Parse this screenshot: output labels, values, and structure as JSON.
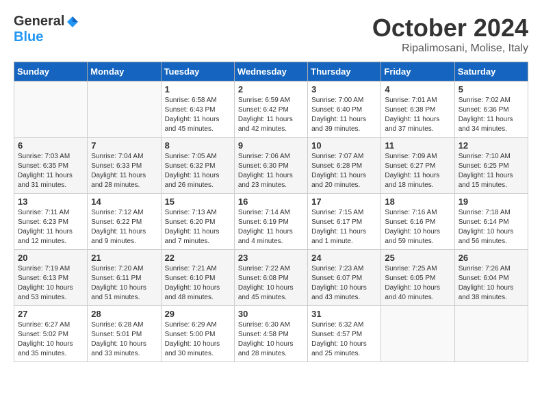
{
  "header": {
    "logo_general": "General",
    "logo_blue": "Blue",
    "month_title": "October 2024",
    "subtitle": "Ripalimosani, Molise, Italy"
  },
  "days_of_week": [
    "Sunday",
    "Monday",
    "Tuesday",
    "Wednesday",
    "Thursday",
    "Friday",
    "Saturday"
  ],
  "weeks": [
    [
      {
        "day": "",
        "info": ""
      },
      {
        "day": "",
        "info": ""
      },
      {
        "day": "1",
        "sunrise": "Sunrise: 6:58 AM",
        "sunset": "Sunset: 6:43 PM",
        "daylight": "Daylight: 11 hours and 45 minutes."
      },
      {
        "day": "2",
        "sunrise": "Sunrise: 6:59 AM",
        "sunset": "Sunset: 6:42 PM",
        "daylight": "Daylight: 11 hours and 42 minutes."
      },
      {
        "day": "3",
        "sunrise": "Sunrise: 7:00 AM",
        "sunset": "Sunset: 6:40 PM",
        "daylight": "Daylight: 11 hours and 39 minutes."
      },
      {
        "day": "4",
        "sunrise": "Sunrise: 7:01 AM",
        "sunset": "Sunset: 6:38 PM",
        "daylight": "Daylight: 11 hours and 37 minutes."
      },
      {
        "day": "5",
        "sunrise": "Sunrise: 7:02 AM",
        "sunset": "Sunset: 6:36 PM",
        "daylight": "Daylight: 11 hours and 34 minutes."
      }
    ],
    [
      {
        "day": "6",
        "sunrise": "Sunrise: 7:03 AM",
        "sunset": "Sunset: 6:35 PM",
        "daylight": "Daylight: 11 hours and 31 minutes."
      },
      {
        "day": "7",
        "sunrise": "Sunrise: 7:04 AM",
        "sunset": "Sunset: 6:33 PM",
        "daylight": "Daylight: 11 hours and 28 minutes."
      },
      {
        "day": "8",
        "sunrise": "Sunrise: 7:05 AM",
        "sunset": "Sunset: 6:32 PM",
        "daylight": "Daylight: 11 hours and 26 minutes."
      },
      {
        "day": "9",
        "sunrise": "Sunrise: 7:06 AM",
        "sunset": "Sunset: 6:30 PM",
        "daylight": "Daylight: 11 hours and 23 minutes."
      },
      {
        "day": "10",
        "sunrise": "Sunrise: 7:07 AM",
        "sunset": "Sunset: 6:28 PM",
        "daylight": "Daylight: 11 hours and 20 minutes."
      },
      {
        "day": "11",
        "sunrise": "Sunrise: 7:09 AM",
        "sunset": "Sunset: 6:27 PM",
        "daylight": "Daylight: 11 hours and 18 minutes."
      },
      {
        "day": "12",
        "sunrise": "Sunrise: 7:10 AM",
        "sunset": "Sunset: 6:25 PM",
        "daylight": "Daylight: 11 hours and 15 minutes."
      }
    ],
    [
      {
        "day": "13",
        "sunrise": "Sunrise: 7:11 AM",
        "sunset": "Sunset: 6:23 PM",
        "daylight": "Daylight: 11 hours and 12 minutes."
      },
      {
        "day": "14",
        "sunrise": "Sunrise: 7:12 AM",
        "sunset": "Sunset: 6:22 PM",
        "daylight": "Daylight: 11 hours and 9 minutes."
      },
      {
        "day": "15",
        "sunrise": "Sunrise: 7:13 AM",
        "sunset": "Sunset: 6:20 PM",
        "daylight": "Daylight: 11 hours and 7 minutes."
      },
      {
        "day": "16",
        "sunrise": "Sunrise: 7:14 AM",
        "sunset": "Sunset: 6:19 PM",
        "daylight": "Daylight: 11 hours and 4 minutes."
      },
      {
        "day": "17",
        "sunrise": "Sunrise: 7:15 AM",
        "sunset": "Sunset: 6:17 PM",
        "daylight": "Daylight: 11 hours and 1 minute."
      },
      {
        "day": "18",
        "sunrise": "Sunrise: 7:16 AM",
        "sunset": "Sunset: 6:16 PM",
        "daylight": "Daylight: 10 hours and 59 minutes."
      },
      {
        "day": "19",
        "sunrise": "Sunrise: 7:18 AM",
        "sunset": "Sunset: 6:14 PM",
        "daylight": "Daylight: 10 hours and 56 minutes."
      }
    ],
    [
      {
        "day": "20",
        "sunrise": "Sunrise: 7:19 AM",
        "sunset": "Sunset: 6:13 PM",
        "daylight": "Daylight: 10 hours and 53 minutes."
      },
      {
        "day": "21",
        "sunrise": "Sunrise: 7:20 AM",
        "sunset": "Sunset: 6:11 PM",
        "daylight": "Daylight: 10 hours and 51 minutes."
      },
      {
        "day": "22",
        "sunrise": "Sunrise: 7:21 AM",
        "sunset": "Sunset: 6:10 PM",
        "daylight": "Daylight: 10 hours and 48 minutes."
      },
      {
        "day": "23",
        "sunrise": "Sunrise: 7:22 AM",
        "sunset": "Sunset: 6:08 PM",
        "daylight": "Daylight: 10 hours and 45 minutes."
      },
      {
        "day": "24",
        "sunrise": "Sunrise: 7:23 AM",
        "sunset": "Sunset: 6:07 PM",
        "daylight": "Daylight: 10 hours and 43 minutes."
      },
      {
        "day": "25",
        "sunrise": "Sunrise: 7:25 AM",
        "sunset": "Sunset: 6:05 PM",
        "daylight": "Daylight: 10 hours and 40 minutes."
      },
      {
        "day": "26",
        "sunrise": "Sunrise: 7:26 AM",
        "sunset": "Sunset: 6:04 PM",
        "daylight": "Daylight: 10 hours and 38 minutes."
      }
    ],
    [
      {
        "day": "27",
        "sunrise": "Sunrise: 6:27 AM",
        "sunset": "Sunset: 5:02 PM",
        "daylight": "Daylight: 10 hours and 35 minutes."
      },
      {
        "day": "28",
        "sunrise": "Sunrise: 6:28 AM",
        "sunset": "Sunset: 5:01 PM",
        "daylight": "Daylight: 10 hours and 33 minutes."
      },
      {
        "day": "29",
        "sunrise": "Sunrise: 6:29 AM",
        "sunset": "Sunset: 5:00 PM",
        "daylight": "Daylight: 10 hours and 30 minutes."
      },
      {
        "day": "30",
        "sunrise": "Sunrise: 6:30 AM",
        "sunset": "Sunset: 4:58 PM",
        "daylight": "Daylight: 10 hours and 28 minutes."
      },
      {
        "day": "31",
        "sunrise": "Sunrise: 6:32 AM",
        "sunset": "Sunset: 4:57 PM",
        "daylight": "Daylight: 10 hours and 25 minutes."
      },
      {
        "day": "",
        "info": ""
      },
      {
        "day": "",
        "info": ""
      }
    ]
  ]
}
